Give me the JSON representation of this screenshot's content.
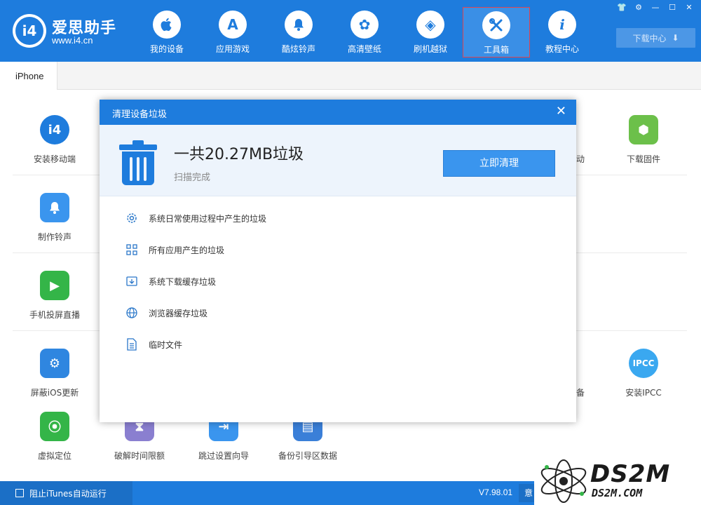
{
  "app": {
    "brand_name": "爱思助手",
    "brand_url": "www.i4.cn",
    "logo_text": "i4"
  },
  "nav": [
    {
      "label": "我的设备",
      "icon": "apple-icon",
      "glyph": ""
    },
    {
      "label": "应用游戏",
      "icon": "app-store-icon",
      "glyph": "A"
    },
    {
      "label": "酷炫铃声",
      "icon": "bell-icon",
      "glyph": "♪"
    },
    {
      "label": "高清壁纸",
      "icon": "flower-icon",
      "glyph": "✿"
    },
    {
      "label": "刷机越狱",
      "icon": "dropbox-icon",
      "glyph": "◈"
    },
    {
      "label": "工具箱",
      "icon": "tools-icon",
      "glyph": "✕",
      "active": true
    },
    {
      "label": "教程中心",
      "icon": "info-icon",
      "glyph": "i"
    }
  ],
  "window_controls": [
    "shirt-icon",
    "gear-icon",
    "minimize-icon",
    "maximize-icon",
    "close-icon"
  ],
  "download_center": {
    "label": "下载中心",
    "icon": "download-icon"
  },
  "device_tab": {
    "label": "iPhone"
  },
  "tools": [
    {
      "label": "安装移动端",
      "color": "#1e7cdd",
      "glyph": "i4"
    },
    {
      "label": "下载固件",
      "color": "#6cc04a",
      "glyph": "⬢"
    },
    {
      "label": "制作铃声",
      "color": "#3a95ee",
      "glyph": "🔔"
    },
    {
      "label": "手机投屏直播",
      "color": "#34b548",
      "glyph": "▶"
    },
    {
      "label": "屏蔽iOS更新",
      "color": "#2f86e0",
      "glyph": "⚙"
    },
    {
      "label": "安装IPCC",
      "color": "#3aa8f0",
      "glyph": "IPCC"
    },
    {
      "label": "虚拟定位",
      "color": "#34b548",
      "glyph": "⦿"
    },
    {
      "label": "破解时间限额",
      "color": "#8a7fd0",
      "glyph": "⧗"
    },
    {
      "label": "跳过设置向导",
      "color": "#3a95ee",
      "glyph": "⇥"
    },
    {
      "label": "备份引导区数据",
      "color": "#3a7fd8",
      "glyph": "▤"
    }
  ],
  "tool_edge_fragments": {
    "row1": "动",
    "row4": "备"
  },
  "statusbar": {
    "itunes_checkbox_label": "阻止iTunes自动运行",
    "version": "V7.98.01",
    "feedback_partial": "意"
  },
  "modal": {
    "title": "清理设备垃圾",
    "total_text": "一共20.27MB垃圾",
    "status_text": "扫描完成",
    "clean_button": "立即清理",
    "items": [
      {
        "label": "系统日常使用过程中产生的垃圾",
        "icon": "gear-icon",
        "glyph": "⚙"
      },
      {
        "label": "所有应用产生的垃圾",
        "icon": "grid-icon",
        "glyph": "⊞"
      },
      {
        "label": "系统下载缓存垃圾",
        "icon": "download-box-icon",
        "glyph": "⇩"
      },
      {
        "label": "浏览器缓存垃圾",
        "icon": "globe-icon",
        "glyph": "◍"
      },
      {
        "label": "临时文件",
        "icon": "document-icon",
        "glyph": "☰"
      }
    ]
  },
  "watermark": {
    "title": "DS2M",
    "subtitle": "DS2M.COM"
  }
}
